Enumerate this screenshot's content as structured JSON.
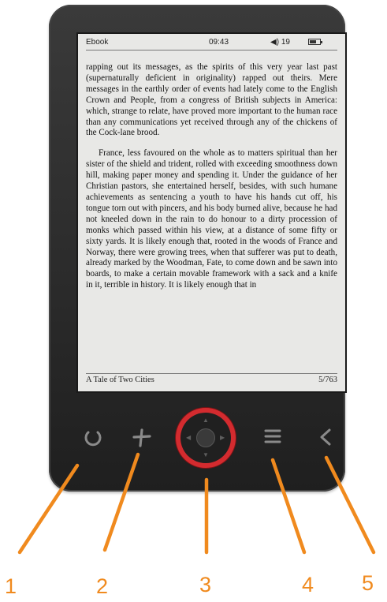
{
  "status_bar": {
    "app_label": "Ebook",
    "time": "09:43",
    "volume_icon": "speaker-icon",
    "volume": "19",
    "battery_icon": "battery-icon",
    "battery_level": 0.7
  },
  "page": {
    "paragraphs": [
      "rapping out its messages, as the spirits of this very year last past (supernaturally deficient in originality) rapped out theirs. Mere messages in the earthly order of events had lately come to the English Crown and People, from a congress of British subjects in America: which, strange to relate, have proved more important to the human race than any communications yet received through any of the chickens of the Cock-lane brood.",
      "France, less favoured on the whole as to matters spiritual than her sister of the shield and trident, rolled with exceeding smoothness down hill, making paper money and spending it. Under the guidance of her Christian pastors, she entertained herself, besides, with such humane achievements as sentencing a youth to have his hands cut off, his tongue torn out with pincers, and his body burned alive, because he had not kneeled down in the rain to do honour to a dirty procession of monks which passed within his view, at a distance of some fifty or sixty yards. It is likely enough that, rooted in the woods of France and Norway, there were growing trees, when that sufferer was put to death, already marked by the Woodman, Fate, to come down and be sawn into boards, to make a certain movable framework with a sack and a knife in it, terrible in history. It is likely enough that in"
    ]
  },
  "footer": {
    "book_title": "A Tale of Two Cities",
    "page_indicator": "5/763"
  },
  "buttons": {
    "power_icon": "power-icon",
    "plus_icon": "plus-icon",
    "menu_icon": "menu-icon",
    "back_icon": "chevron-left-icon",
    "dpad": "navigation-dpad"
  },
  "callouts": {
    "labels": [
      "1",
      "2",
      "3",
      "4",
      "5"
    ],
    "color": "#f08a1e"
  },
  "colors": {
    "device_body": "#2a2a2a",
    "screen": "#e8e8e6",
    "dpad_ring": "#d32b2f",
    "button_icon": "#8a8a8a"
  }
}
